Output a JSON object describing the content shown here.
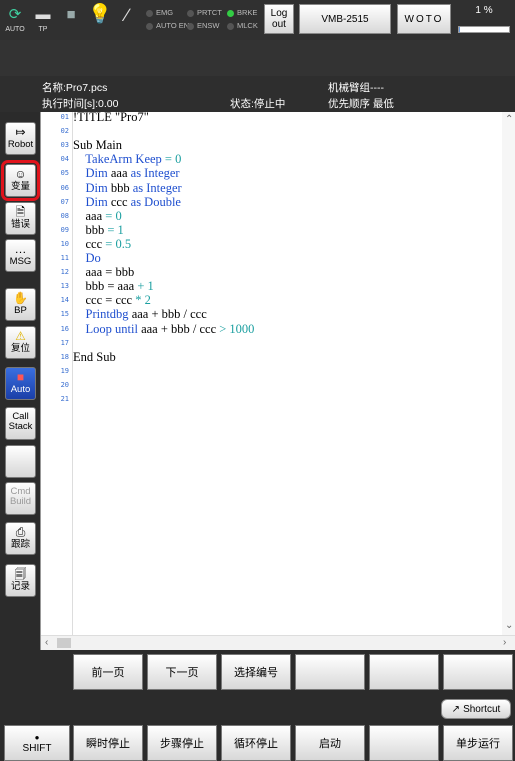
{
  "topbar": {
    "auto_label": "AUTO",
    "tp_label": "TP",
    "leds": [
      {
        "label": "EMG",
        "on": false
      },
      {
        "label": "AUTO EN",
        "on": false
      },
      {
        "label": "PRTCT",
        "on": false
      },
      {
        "label": "ENSW",
        "on": false
      },
      {
        "label": "BRKE",
        "on": true
      },
      {
        "label": "MLCK",
        "on": false
      }
    ],
    "logout_label": "Log\nout",
    "robot_model": "VMB-2515",
    "woto_label": "WOTO",
    "speed_label": "1 %",
    "speed_fraction": 0.01
  },
  "info": {
    "name": "名称:Pro7.pcs",
    "exec_time": "执行时间[s]:0.00",
    "status": "状态:停止中",
    "arm_group": "机械臂组----",
    "priority": "优先顺序 最低"
  },
  "sidebar": {
    "robot": "Robot",
    "variable": "变量",
    "error": "错误",
    "msg": "MSG",
    "bp": "BP",
    "reset": "复位",
    "auto": "Auto",
    "call_stack_1": "Call",
    "call_stack_2": "Stack",
    "cmd_build_1": "Cmd",
    "cmd_build_2": "Build",
    "trace": "跟踪",
    "log": "记录"
  },
  "editor": {
    "line_numbers": [
      "01",
      "02",
      "03",
      "04",
      "05",
      "06",
      "07",
      "08",
      "09",
      "10",
      "11",
      "12",
      "13",
      "14",
      "15",
      "16",
      "17",
      "18",
      "19",
      "20",
      "21"
    ],
    "lines": [
      [
        {
          "t": "!TITLE \"Pro7\"",
          "c": "#000"
        }
      ],
      [],
      [
        {
          "t": "Sub Main",
          "c": "#000"
        }
      ],
      [
        {
          "t": "    TakeArm Keep ",
          "c": "#1f4fcf"
        },
        {
          "t": "= 0",
          "c": "#1b9fa0"
        }
      ],
      [
        {
          "t": "    Dim ",
          "c": "#1f4fcf"
        },
        {
          "t": "aaa ",
          "c": "#000"
        },
        {
          "t": "as Integer",
          "c": "#1f4fcf"
        }
      ],
      [
        {
          "t": "    Dim ",
          "c": "#1f4fcf"
        },
        {
          "t": "bbb ",
          "c": "#000"
        },
        {
          "t": "as Integer",
          "c": "#1f4fcf"
        }
      ],
      [
        {
          "t": "    Dim ",
          "c": "#1f4fcf"
        },
        {
          "t": "ccc ",
          "c": "#000"
        },
        {
          "t": "as Double",
          "c": "#1f4fcf"
        }
      ],
      [
        {
          "t": "    aaa ",
          "c": "#000"
        },
        {
          "t": "= 0",
          "c": "#1b9fa0"
        }
      ],
      [
        {
          "t": "    bbb ",
          "c": "#000"
        },
        {
          "t": "= 1",
          "c": "#1b9fa0"
        }
      ],
      [
        {
          "t": "    ccc ",
          "c": "#000"
        },
        {
          "t": "= 0.5",
          "c": "#1b9fa0"
        }
      ],
      [
        {
          "t": "    Do",
          "c": "#1f4fcf"
        }
      ],
      [
        {
          "t": "    aaa = bbb",
          "c": "#000"
        }
      ],
      [
        {
          "t": "    bbb = aaa ",
          "c": "#000"
        },
        {
          "t": "+ 1",
          "c": "#1b9fa0"
        }
      ],
      [
        {
          "t": "    ccc = ccc ",
          "c": "#000"
        },
        {
          "t": "* 2",
          "c": "#1b9fa0"
        }
      ],
      [
        {
          "t": "    Printdbg ",
          "c": "#1f4fcf"
        },
        {
          "t": "aaa + bbb / ccc",
          "c": "#000"
        }
      ],
      [
        {
          "t": "    Loop until ",
          "c": "#1f4fcf"
        },
        {
          "t": "aaa + bbb / ccc ",
          "c": "#000"
        },
        {
          "t": "> 1000",
          "c": "#1b9fa0"
        }
      ],
      [],
      [
        {
          "t": "End Sub",
          "c": "#000"
        }
      ],
      [],
      [],
      []
    ]
  },
  "fn_row_1": [
    "前一页",
    "下一页",
    "选择编号",
    "",
    "",
    ""
  ],
  "shortcut_label": "Shortcut",
  "fn_row_2": {
    "shift": "SHIFT",
    "buttons": [
      "瞬时停止",
      "步骤停止",
      "循环停止",
      "启动",
      "",
      "单步运行"
    ]
  },
  "colors": {
    "keyword": "#1f4fcf",
    "number": "#1b9fa0",
    "line_number": "#3a6fd0",
    "highlight": "#e0141c",
    "led_on": "#33cc44"
  }
}
